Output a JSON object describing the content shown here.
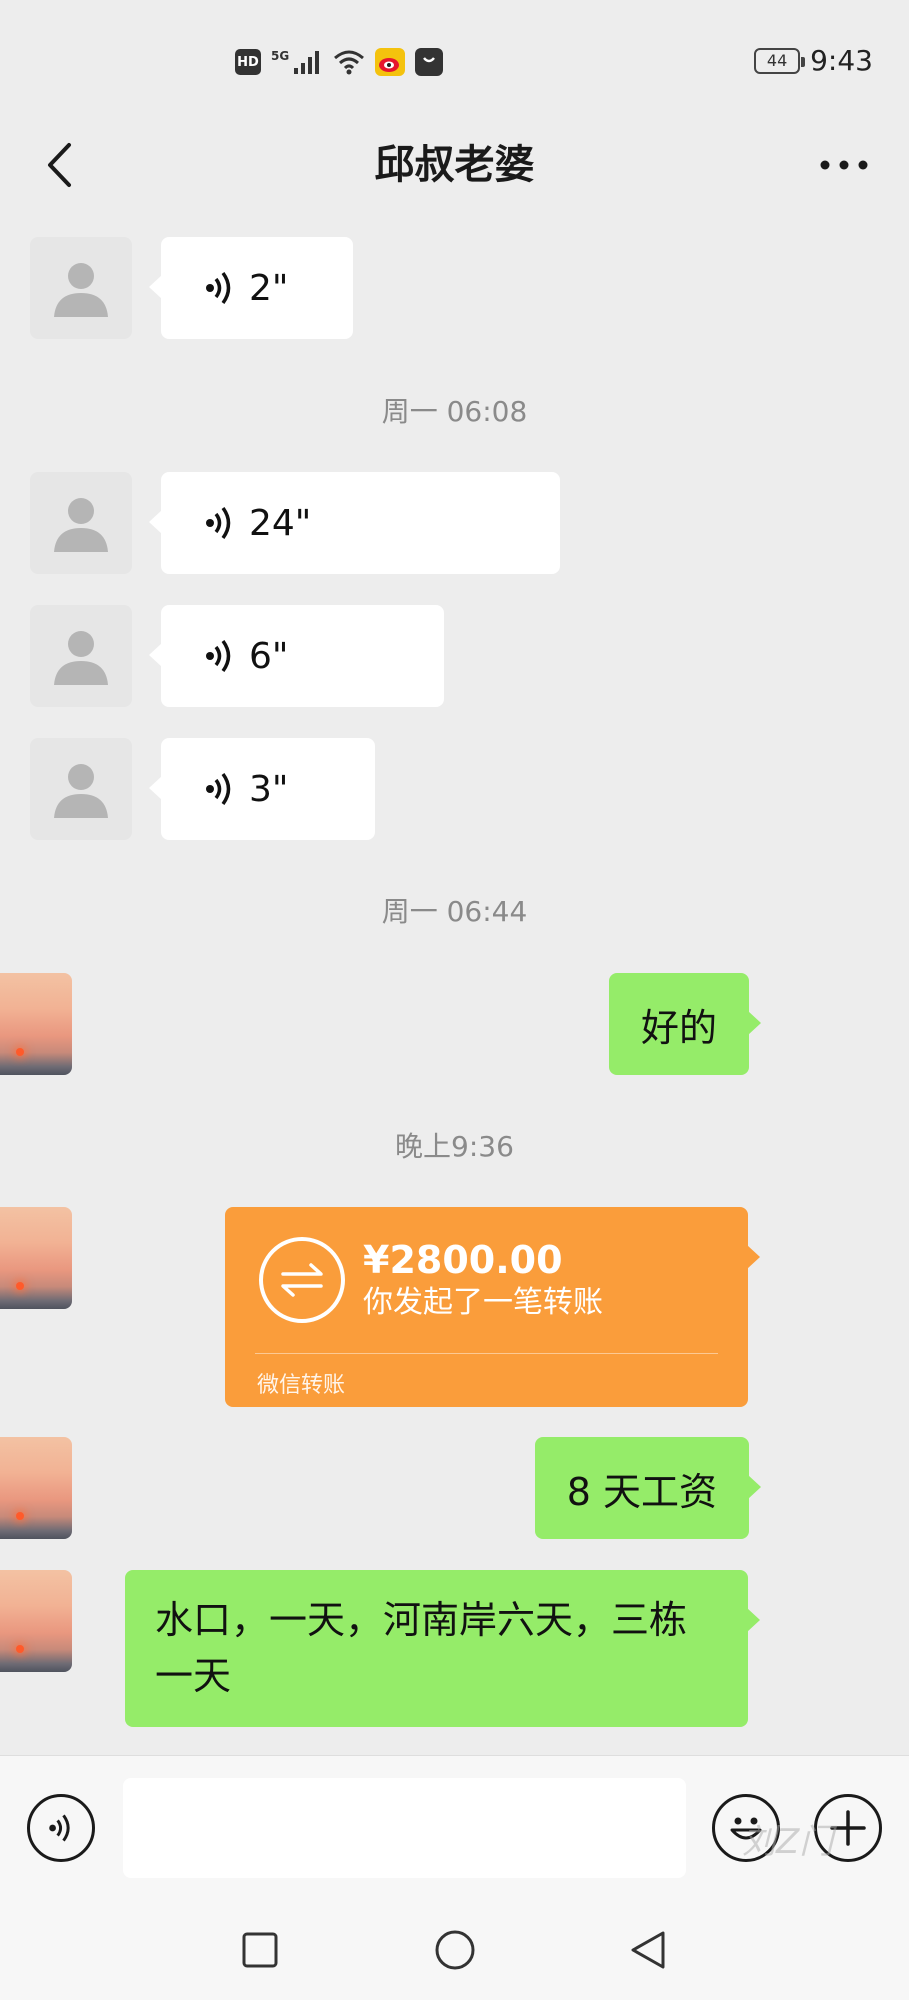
{
  "status_bar": {
    "hd": "HD",
    "network": "5G",
    "battery": "44",
    "time": "9:43"
  },
  "header": {
    "title": "邱叔老婆"
  },
  "messages": {
    "voice1": "2\"",
    "ts1": "周一 06:08",
    "voice2": "24\"",
    "voice3": "6\"",
    "voice4": "3\"",
    "ts2": "周一 06:44",
    "text1": "好的",
    "ts3": "晚上9:36",
    "transfer": {
      "amount": "¥2800.00",
      "desc": "你发起了一笔转账",
      "footer": "微信转账"
    },
    "text2": "8 天工资",
    "text3": "水口，一天，河南岸六天，三栋一天"
  },
  "input": {
    "value": "",
    "watermark": "刘Z门"
  },
  "colors": {
    "background": "#ededed",
    "green_bubble": "#95ec69",
    "transfer_orange": "#fa9d3b"
  }
}
